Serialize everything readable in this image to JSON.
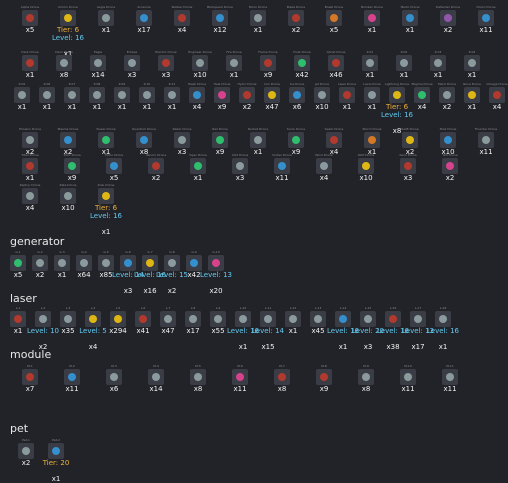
{
  "palette": [
    "#c0392b",
    "#e67e22",
    "#f1c40f",
    "#2ecc71",
    "#3498db",
    "#9b59b6",
    "#1abc9c",
    "#e84393",
    "#95a5a6",
    "#d35400"
  ],
  "drones": [
    {
      "label": "Alpha Drone",
      "count": "x5",
      "color": "#c0392b"
    },
    {
      "label": "Ammo Drone",
      "count": "Tier: 6",
      "tier": true,
      "sub": "Level: 16",
      "sub2": "x1",
      "color": "#f1c40f"
    },
    {
      "label": "Aegis Drone",
      "count": "x1",
      "color": "#95a5a6"
    },
    {
      "label": "Arcanine",
      "count": "x17",
      "color": "#3498db"
    },
    {
      "label": "Rubber Drone",
      "count": "x4",
      "color": "#c0392b"
    },
    {
      "label": "Blackpearl Drone",
      "count": "x12",
      "color": "#3498db"
    },
    {
      "label": "Moon Drone",
      "count": "x1",
      "color": "#95a5a6"
    },
    {
      "label": "Blaze Drone",
      "count": "x2",
      "color": "#c0392b"
    },
    {
      "label": "Brawl Drone",
      "count": "x5",
      "color": "#e67e22"
    },
    {
      "label": "Bomber Drone",
      "count": "x1",
      "color": "#e84393"
    },
    {
      "label": "Medic Drone",
      "count": "x1",
      "color": "#3498db"
    },
    {
      "label": "Defender Drone",
      "count": "x2",
      "color": "#9b59b6"
    },
    {
      "label": "Doom Drone",
      "count": "x11",
      "color": "#3498db"
    },
    {
      "label": "Dark Drone",
      "count": "x1",
      "color": "#c0392b"
    },
    {
      "label": "Devil Drone",
      "count": "x8",
      "color": "#95a5a6"
    },
    {
      "label": "Eagle",
      "count": "x14",
      "color": "#95a5a6"
    },
    {
      "label": "Eclipse",
      "count": "x3",
      "color": "#95a5a6"
    },
    {
      "label": "Electric Drone",
      "count": "x3",
      "color": "#c0392b"
    },
    {
      "label": "Engineer Drone",
      "count": "x10",
      "color": "#95a5a6"
    },
    {
      "label": "Fire Drone",
      "count": "x1",
      "color": "#95a5a6"
    },
    {
      "label": "Flame Drone",
      "count": "x9",
      "color": "#c0392b"
    },
    {
      "label": "Frost Drone",
      "count": "x42",
      "color": "#2ecc71"
    },
    {
      "label": "Ghost Drone",
      "count": "x46",
      "color": "#c0392b"
    },
    {
      "label": "P-01",
      "count": "x1",
      "color": "#95a5a6"
    },
    {
      "label": "P-02",
      "count": "x1",
      "color": "#95a5a6"
    },
    {
      "label": "P-03",
      "count": "x1",
      "color": "#95a5a6"
    },
    {
      "label": "P-04",
      "count": "x1",
      "color": "#95a5a6"
    },
    {
      "label": "P-05",
      "count": "x1",
      "color": "#95a5a6"
    },
    {
      "label": "P-06",
      "count": "x1",
      "color": "#95a5a6"
    },
    {
      "label": "P-07",
      "count": "x1",
      "color": "#95a5a6"
    },
    {
      "label": "P-08",
      "count": "x1",
      "color": "#95a5a6"
    },
    {
      "label": "P-09",
      "count": "x1",
      "color": "#95a5a6"
    },
    {
      "label": "P-10",
      "count": "x1",
      "color": "#95a5a6"
    },
    {
      "label": "P-11",
      "count": "x1",
      "color": "#95a5a6"
    },
    {
      "label": "Hawk Drone",
      "count": "x4",
      "color": "#3498db"
    },
    {
      "label": "Heal Drone",
      "count": "x9",
      "color": "#e84393"
    },
    {
      "label": "Hydro Drone",
      "count": "x2",
      "color": "#c0392b"
    },
    {
      "label": "Iron Drone",
      "count": "x47",
      "color": "#f1c40f"
    },
    {
      "label": "Ice Drone",
      "count": "x6",
      "color": "#3498db"
    },
    {
      "label": "Jet Drone",
      "count": "x10",
      "color": "#95a5a6"
    },
    {
      "label": "Laser Drone",
      "count": "x1",
      "color": "#c0392b"
    },
    {
      "label": "Lava Drone",
      "count": "x1",
      "color": "#95a5a6"
    },
    {
      "label": "Lightning Drone",
      "count": "Tier: 6",
      "tier": true,
      "sub": "Level: 16",
      "sub2": "x8",
      "color": "#f1c40f"
    },
    {
      "label": "Magma Drone",
      "count": "x4",
      "color": "#2ecc71"
    },
    {
      "label": "Mech Drone",
      "count": "x2",
      "color": "#95a5a6"
    },
    {
      "label": "Nova Drone",
      "count": "x1",
      "color": "#f1c40f"
    },
    {
      "label": "Omega Drone",
      "count": "x4",
      "color": "#c0392b"
    },
    {
      "label": "Phoenix Drone",
      "count": "x2",
      "color": "#95a5a6"
    },
    {
      "label": "Plasma Drone",
      "count": "x2",
      "color": "#3498db"
    },
    {
      "label": "Power Drone",
      "count": "x1",
      "color": "#2ecc71"
    },
    {
      "label": "Quantum Drone",
      "count": "x8",
      "color": "#3498db"
    },
    {
      "label": "Radar Drone",
      "count": "x3",
      "color": "#95a5a6"
    },
    {
      "label": "Rail Drone",
      "count": "x9",
      "color": "#2ecc71"
    },
    {
      "label": "Rocket Drone",
      "count": "x1",
      "color": "#95a5a6"
    },
    {
      "label": "Sonic Drone",
      "count": "x9",
      "color": "#2ecc71"
    },
    {
      "label": "Spark Drone",
      "count": "x4",
      "color": "#c0392b"
    },
    {
      "label": "Storm Drone",
      "count": "x1",
      "color": "#e67e22"
    },
    {
      "label": "Swift Drone",
      "count": "x2",
      "color": "#f1c40f"
    },
    {
      "label": "Tank Drone",
      "count": "x10",
      "color": "#3498db"
    },
    {
      "label": "Thunder Drone",
      "count": "x11",
      "color": "#95a5a6"
    },
    {
      "label": "Titan Drone",
      "count": "x1",
      "color": "#c0392b"
    },
    {
      "label": "Toxic Drone",
      "count": "x9",
      "color": "#2ecc71"
    },
    {
      "label": "Turbo Drone",
      "count": "x5",
      "color": "#3498db"
    },
    {
      "label": "Venom Drone",
      "count": "x2",
      "color": "#c0392b"
    },
    {
      "label": "Viper Drone",
      "count": "x1",
      "color": "#2ecc71"
    },
    {
      "label": "Void Drone",
      "count": "x3",
      "color": "#95a5a6"
    },
    {
      "label": "Vortex Drone",
      "count": "x11",
      "color": "#3498db"
    },
    {
      "label": "Wind Drone",
      "count": "x4",
      "color": "#95a5a6"
    },
    {
      "label": "Wolf Drone",
      "count": "x10",
      "color": "#f1c40f"
    },
    {
      "label": "Xeno Drone",
      "count": "x3",
      "color": "#c0392b"
    },
    {
      "label": "Yeti Drone",
      "count": "x2",
      "color": "#e84393"
    },
    {
      "label": "Zephyr Drone",
      "count": "x4",
      "color": "#95a5a6"
    },
    {
      "label": "Zeta Drone",
      "count": "x10",
      "color": "#95a5a6"
    },
    {
      "label": "Zulu Drone",
      "count": "Tier: 6",
      "tier": true,
      "sub": "Level: 16",
      "sub2": "x1",
      "color": "#f1c40f"
    }
  ],
  "generator_heading": "generator",
  "generator": [
    {
      "label": "G-1",
      "count": "x5",
      "color": "#2ecc71"
    },
    {
      "label": "G-2",
      "count": "x2",
      "color": "#95a5a6"
    },
    {
      "label": "G-3",
      "count": "x1",
      "color": "#95a5a6"
    },
    {
      "label": "G-4",
      "count": "x64",
      "color": "#95a5a6"
    },
    {
      "label": "G-5",
      "count": "x85",
      "color": "#95a5a6"
    },
    {
      "label": "G-6",
      "count": "Level: 14",
      "lvl": true,
      "sub2": "x3",
      "color": "#3498db"
    },
    {
      "label": "G-7",
      "count": "Level: 16",
      "lvl": true,
      "sub2": "x16",
      "color": "#f1c40f"
    },
    {
      "label": "G-8",
      "count": "Level: 15",
      "lvl": true,
      "sub2": "x2",
      "color": "#95a5a6"
    },
    {
      "label": "G-9",
      "count": "x42",
      "color": "#3498db"
    },
    {
      "label": "G-10",
      "count": "Level: 13",
      "lvl": true,
      "sub2": "x20",
      "color": "#e84393"
    }
  ],
  "laser_heading": "laser",
  "laser": [
    {
      "label": "L-1",
      "count": "x1",
      "color": "#c0392b"
    },
    {
      "label": "L-2",
      "count": "Level: 10",
      "lvl": true,
      "sub2": "x2",
      "color": "#95a5a6"
    },
    {
      "label": "L-3",
      "count": "x35",
      "color": "#95a5a6"
    },
    {
      "label": "L-4",
      "count": "Level: 5",
      "lvl": true,
      "sub2": "x4",
      "color": "#f1c40f"
    },
    {
      "label": "L-5",
      "count": "x294",
      "color": "#f1c40f"
    },
    {
      "label": "L-6",
      "count": "x41",
      "color": "#c0392b"
    },
    {
      "label": "L-7",
      "count": "x47",
      "color": "#95a5a6"
    },
    {
      "label": "L-8",
      "count": "x17",
      "color": "#95a5a6"
    },
    {
      "label": "L-9",
      "count": "x55",
      "color": "#95a5a6"
    },
    {
      "label": "L-10",
      "count": "Level: 16",
      "lvl": true,
      "sub2": "x1",
      "color": "#95a5a6"
    },
    {
      "label": "L-11",
      "count": "Level: 14",
      "lvl": true,
      "sub2": "x15",
      "color": "#95a5a6"
    },
    {
      "label": "L-12",
      "count": "x1",
      "color": "#95a5a6"
    },
    {
      "label": "L-13",
      "count": "x45",
      "color": "#95a5a6"
    },
    {
      "label": "L-14",
      "count": "Level: 16",
      "lvl": true,
      "sub2": "x1",
      "color": "#3498db"
    },
    {
      "label": "L-15",
      "count": "Level: 20",
      "lvl": true,
      "sub2": "x3",
      "color": "#95a5a6"
    },
    {
      "label": "L-16",
      "count": "Level: 16",
      "lvl": true,
      "sub2": "x38",
      "color": "#c0392b"
    },
    {
      "label": "L-17",
      "count": "Level: 13",
      "lvl": true,
      "sub2": "x17",
      "color": "#95a5a6"
    },
    {
      "label": "L-18",
      "count": "Level: 16",
      "lvl": true,
      "sub2": "x1",
      "color": "#95a5a6"
    }
  ],
  "module_heading": "module",
  "module": [
    {
      "label": "M-1",
      "count": "x7",
      "color": "#c0392b"
    },
    {
      "label": "M-2",
      "count": "x11",
      "color": "#3498db"
    },
    {
      "label": "M-3",
      "count": "x6",
      "color": "#95a5a6"
    },
    {
      "label": "M-4",
      "count": "x14",
      "color": "#95a5a6"
    },
    {
      "label": "M-5",
      "count": "x8",
      "color": "#95a5a6"
    },
    {
      "label": "M-6",
      "count": "x11",
      "color": "#e84393"
    },
    {
      "label": "M-7",
      "count": "x8",
      "color": "#c0392b"
    },
    {
      "label": "M-8",
      "count": "x9",
      "color": "#c0392b"
    },
    {
      "label": "M-9",
      "count": "x8",
      "color": "#95a5a6"
    },
    {
      "label": "M-10",
      "count": "x11",
      "color": "#95a5a6"
    },
    {
      "label": "M-11",
      "count": "x11",
      "color": "#95a5a6"
    }
  ],
  "pet_heading": "pet",
  "pet": [
    {
      "label": "Pet-1",
      "count": "x2",
      "color": "#95a5a6"
    },
    {
      "label": "Pet-2",
      "count": "Tier: 20",
      "tier": true,
      "sub2": "x1",
      "color": "#3498db"
    }
  ]
}
